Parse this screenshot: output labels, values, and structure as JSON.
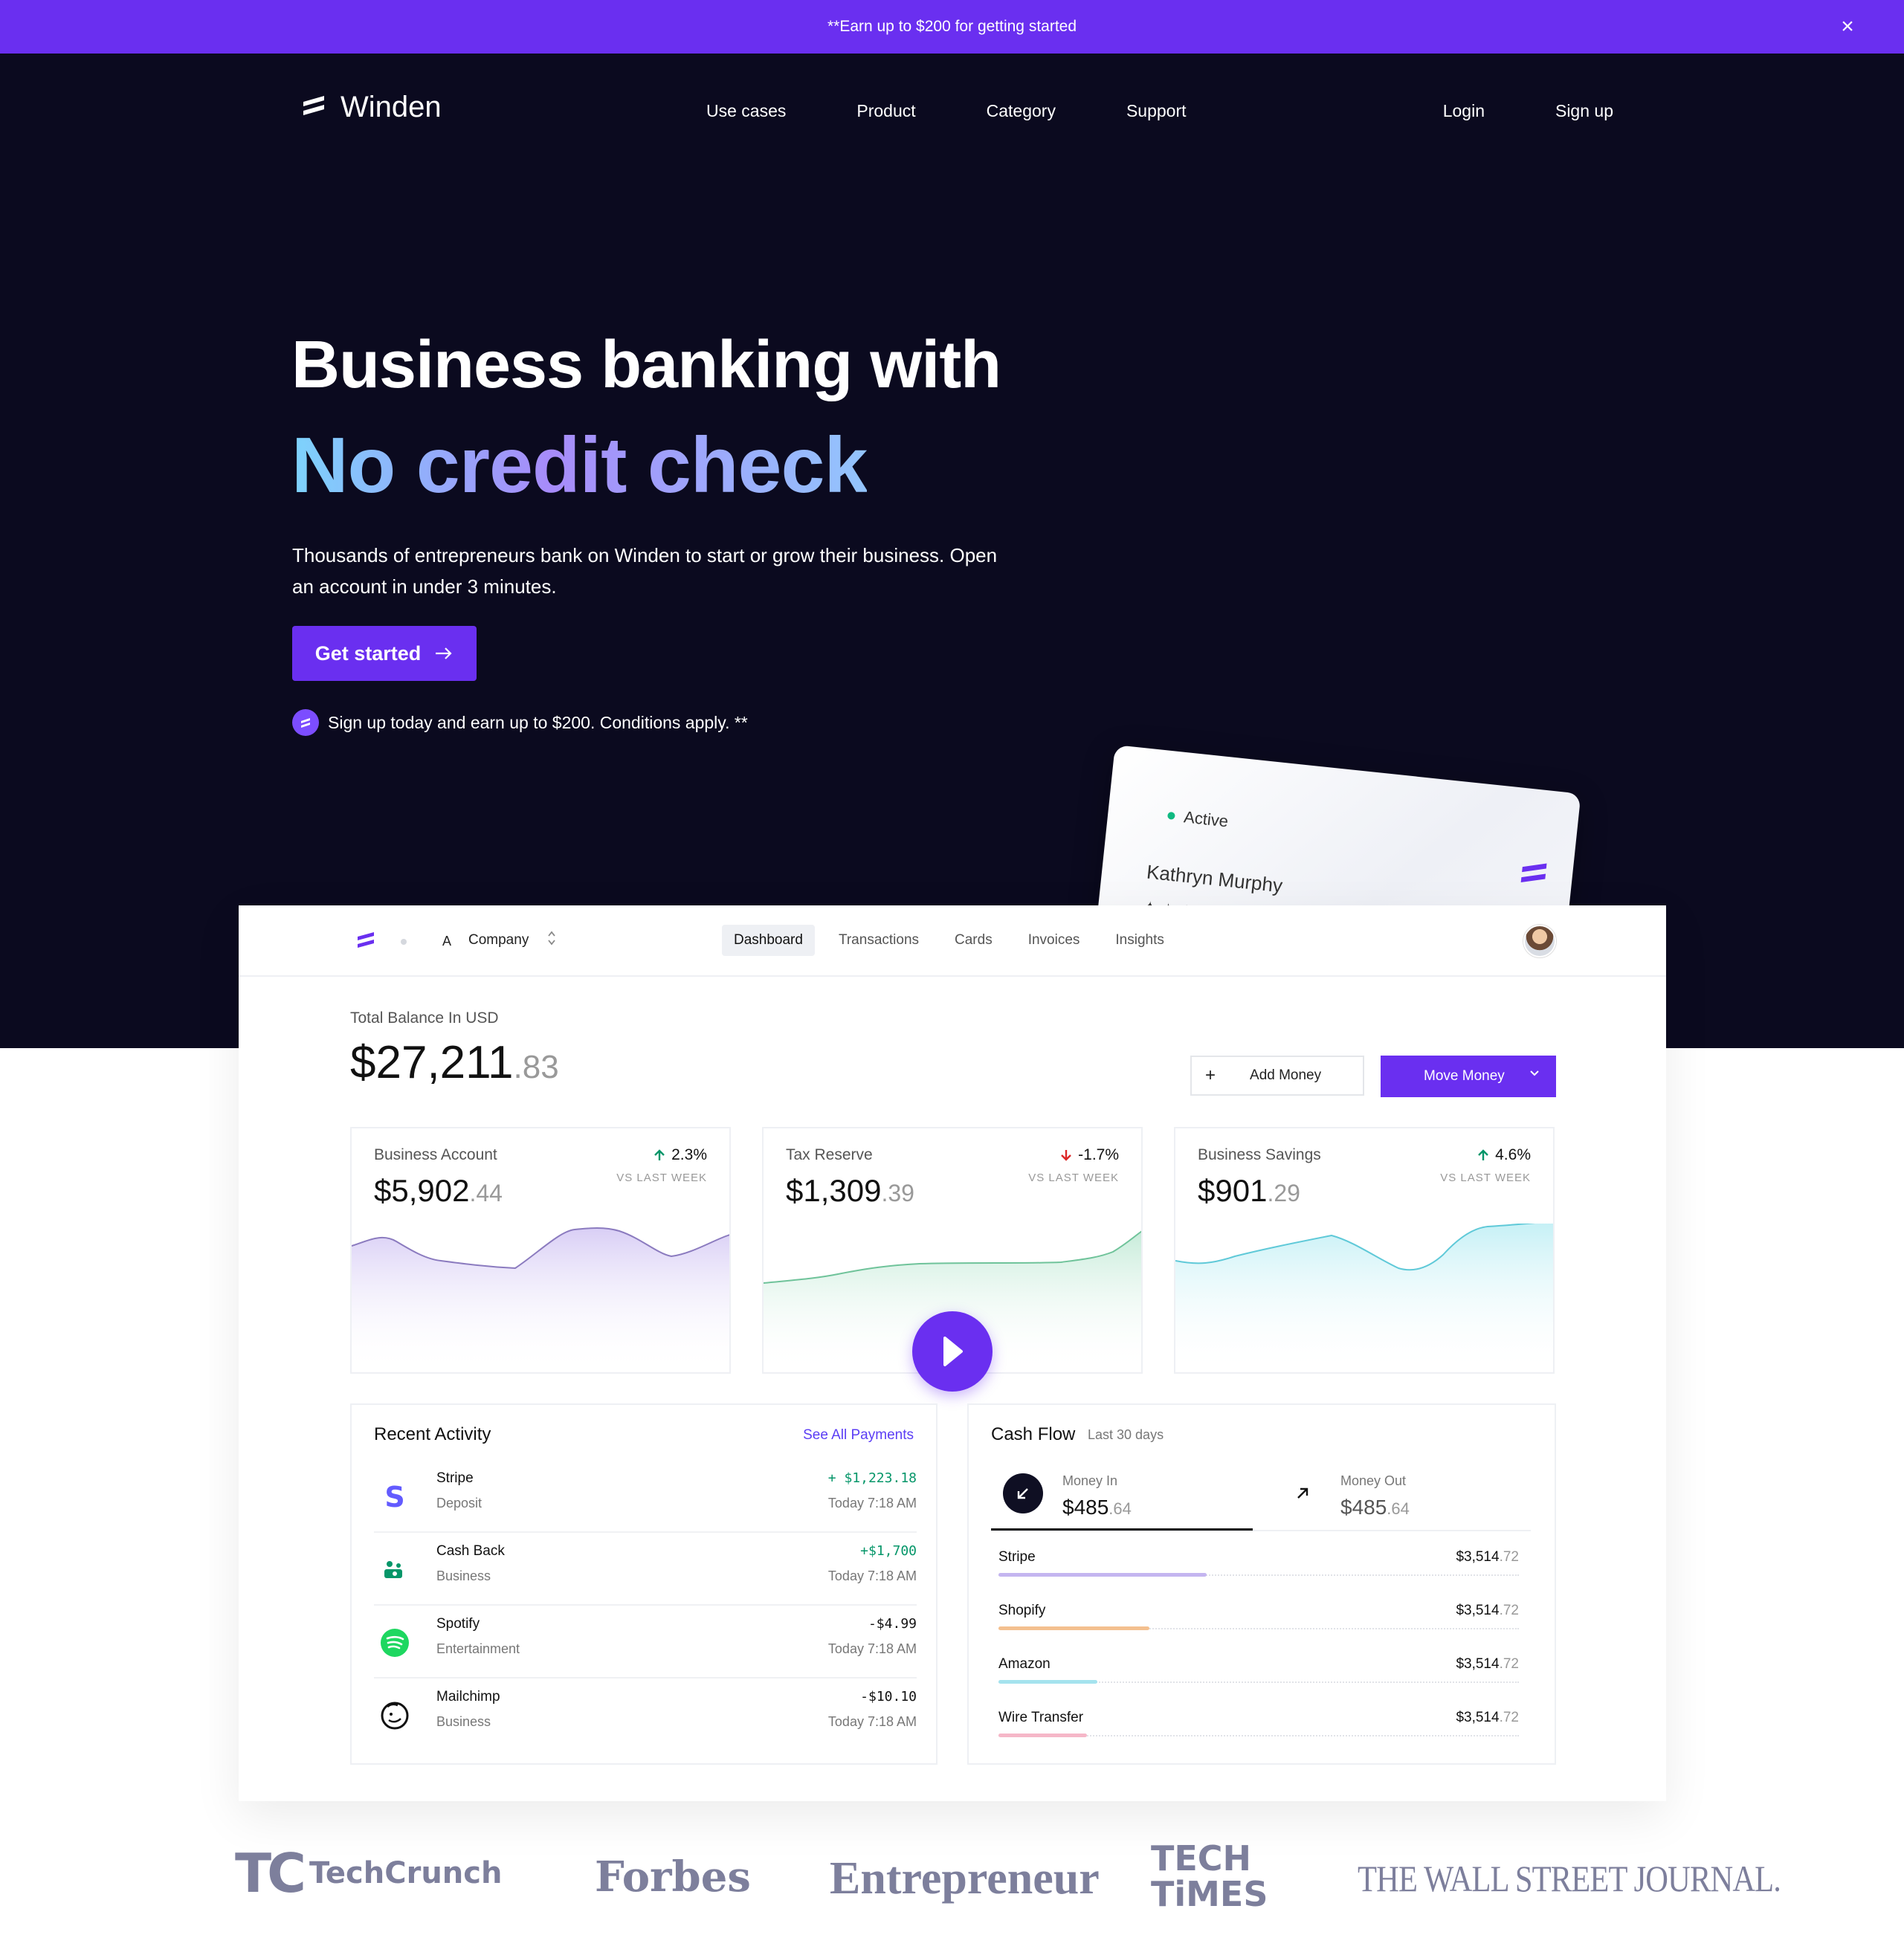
{
  "banner": {
    "text": "**Earn up to $200 for getting started",
    "close_icon": "×"
  },
  "nav": {
    "brand": "Winden",
    "links": [
      "Use cases",
      "Product",
      "Category",
      "Support"
    ],
    "login": "Login",
    "signup": "Sign up"
  },
  "hero": {
    "title_line1": "Business banking with",
    "title_line2": "No credit check",
    "lead": "Thousands of entrepreneurs bank on Winden to start or grow their business. Open an account in under 3 minutes.",
    "cta_label": "Get started",
    "note": "Sign up today and earn up to $200. Conditions apply. **"
  },
  "card": {
    "status": "Active",
    "holder": "Kathryn Murphy",
    "number_mask": "✦✦✦✦  ✦✦✦✦"
  },
  "dashboard": {
    "company_initial": "A",
    "company": "Company",
    "tabs": [
      "Dashboard",
      "Transactions",
      "Cards",
      "Invoices",
      "Insights"
    ],
    "active_tab": "Dashboard",
    "total_label": "Total Balance In USD",
    "total_whole": "$27,211",
    "total_cents": ".83",
    "add_money": "Add Money",
    "move_money": "Move Money",
    "accounts": [
      {
        "name": "Business Account",
        "whole": "$5,902",
        "cents": ".44",
        "change": "2.3%",
        "direction": "up",
        "vs": "VS LAST WEEK"
      },
      {
        "name": "Tax Reserve",
        "whole": "$1,309",
        "cents": ".39",
        "change": "-1.7%",
        "direction": "down",
        "vs": "VS LAST WEEK"
      },
      {
        "name": "Business Savings",
        "whole": "$901",
        "cents": ".29",
        "change": "4.6%",
        "direction": "up",
        "vs": "VS LAST WEEK"
      }
    ],
    "recent": {
      "title": "Recent Activity",
      "see_all": "See All Payments",
      "items": [
        {
          "name": "Stripe",
          "sub": "Deposit",
          "amount": "+ $1,223.18",
          "time": "Today 7:18 AM",
          "icon": "stripe-icon"
        },
        {
          "name": "Cash Back",
          "sub": "Business",
          "amount": "+$1,700",
          "time": "Today 7:18 AM",
          "icon": "cashback-icon"
        },
        {
          "name": "Spotify",
          "sub": "Entertainment",
          "amount": "-$4.99",
          "time": "Today 7:18 AM",
          "icon": "spotify-icon"
        },
        {
          "name": "Mailchimp",
          "sub": "Business",
          "amount": "-$10.10",
          "time": "Today 7:18 AM",
          "icon": "mailchimp-icon"
        }
      ]
    },
    "cashflow": {
      "title": "Cash Flow",
      "period": "Last 30 days",
      "money_in_label": "Money In",
      "money_in_whole": "$485",
      "money_in_cents": ".64",
      "money_out_label": "Money Out",
      "money_out_whole": "$485",
      "money_out_cents": ".64",
      "rows": [
        {
          "name": "Stripe",
          "whole": "$3,514",
          "cents": ".72",
          "share": 0.4,
          "color": "#c4b5f0"
        },
        {
          "name": "Shopify",
          "whole": "$3,514",
          "cents": ".72",
          "share": 0.29,
          "color": "#f4c08f"
        },
        {
          "name": "Amazon",
          "whole": "$3,514",
          "cents": ".72",
          "share": 0.19,
          "color": "#a5e3ee"
        },
        {
          "name": "Wire Transfer",
          "whole": "$3,514",
          "cents": ".72",
          "share": 0.17,
          "color": "#f6b7c8"
        }
      ]
    }
  },
  "press": {
    "techcrunch_mark": "TC",
    "techcrunch": "TechCrunch",
    "forbes": "Forbes",
    "entrepreneur": "Entrepreneur",
    "techtimes_line1": "TECH",
    "techtimes_line2": "TiMES",
    "wsj": "THE WALL STREET JOURNAL."
  },
  "colors": {
    "brand": "#6a2ff0",
    "hero_bg": "#0b0a1f",
    "positive": "#059669",
    "negative": "#dc2626"
  }
}
